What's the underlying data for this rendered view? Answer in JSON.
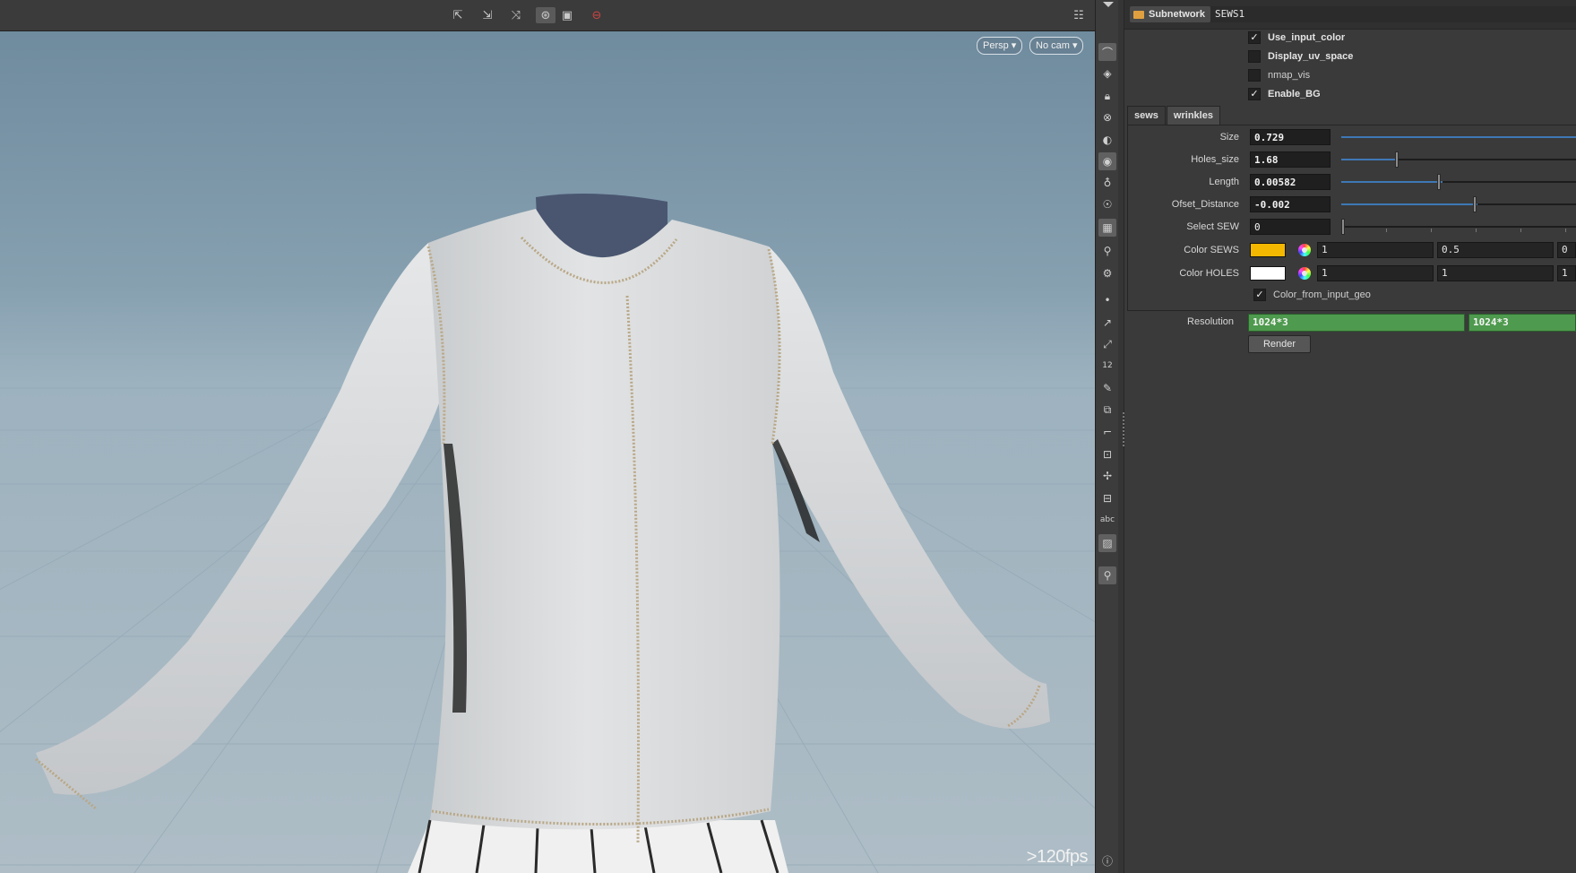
{
  "viewport": {
    "camera_menu": "Persp",
    "cam_select": "No cam",
    "fps": ">120fps"
  },
  "panel": {
    "node_type": "Subnetwork",
    "node_name": "SEWS1",
    "checkboxes": [
      {
        "label": "Use_input_color",
        "checked": true
      },
      {
        "label": "Display_uv_space",
        "checked": false
      },
      {
        "label": "nmap_vis",
        "checked": false
      },
      {
        "label": "Enable_BG",
        "checked": true
      }
    ],
    "tabs": [
      "sews",
      "wrinkles"
    ],
    "active_tab": "sews",
    "params": {
      "size": {
        "label": "Size",
        "value": "0.729",
        "slider_fraction": 1.0
      },
      "holes_size": {
        "label": "Holes_size",
        "value": "1.68",
        "slider_fraction": 0.25
      },
      "length": {
        "label": "Length",
        "value": "0.00582",
        "slider_fraction": 0.43
      },
      "ofset_distance": {
        "label": "Ofset_Distance",
        "value": "-0.002",
        "slider_fraction": 0.6
      },
      "select_sew": {
        "label": "Select SEW",
        "value": "0",
        "slider_fraction": 0.0
      }
    },
    "color_sews": {
      "label": "Color SEWS",
      "swatch": "#f5b800",
      "r": "1",
      "g": "0.5",
      "b": "0"
    },
    "color_holes": {
      "label": "Color HOLES",
      "swatch": "#ffffff",
      "r": "1",
      "g": "1",
      "b": "1"
    },
    "color_from_input": {
      "label": "Color_from_input_geo",
      "checked": true
    },
    "resolution": {
      "label": "Resolution",
      "value1": "1024*3",
      "value2": "1024*3"
    },
    "render_label": "Render",
    "check_mark": "✓"
  },
  "toolbar_icons": {
    "help": "?",
    "text_tool": "abc"
  }
}
